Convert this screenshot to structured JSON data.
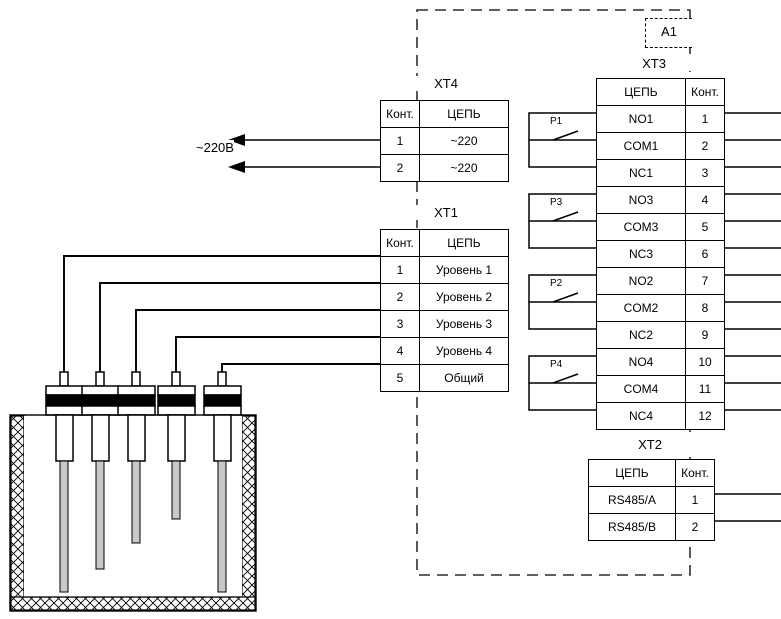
{
  "diagram": {
    "enclosure_label": "A1",
    "mains_label": "~220В",
    "header_pin": "Конт.",
    "header_circuit": "ЦЕПЬ"
  },
  "terminals": {
    "xt4": {
      "title": "XT4",
      "columns": [
        "Конт.",
        "ЦЕПЬ"
      ],
      "rows": [
        {
          "pin": "1",
          "circuit": "~220"
        },
        {
          "pin": "2",
          "circuit": "~220"
        }
      ]
    },
    "xt1": {
      "title": "XT1",
      "columns": [
        "Конт.",
        "ЦЕПЬ"
      ],
      "rows": [
        {
          "pin": "1",
          "circuit": "Уровень 1"
        },
        {
          "pin": "2",
          "circuit": "Уровень 2"
        },
        {
          "pin": "3",
          "circuit": "Уровень 3"
        },
        {
          "pin": "4",
          "circuit": "Уровень 4"
        },
        {
          "pin": "5",
          "circuit": "Общий"
        }
      ]
    },
    "xt3": {
      "title": "XT3",
      "columns": [
        "ЦЕПЬ",
        "Конт."
      ],
      "rows": [
        {
          "circuit": "NO1",
          "pin": "1"
        },
        {
          "circuit": "COM1",
          "pin": "2"
        },
        {
          "circuit": "NC1",
          "pin": "3"
        },
        {
          "circuit": "NO3",
          "pin": "4"
        },
        {
          "circuit": "COM3",
          "pin": "5"
        },
        {
          "circuit": "NC3",
          "pin": "6"
        },
        {
          "circuit": "NO2",
          "pin": "7"
        },
        {
          "circuit": "COM2",
          "pin": "8"
        },
        {
          "circuit": "NC2",
          "pin": "9"
        },
        {
          "circuit": "NO4",
          "pin": "10"
        },
        {
          "circuit": "COM4",
          "pin": "11"
        },
        {
          "circuit": "NC4",
          "pin": "12"
        }
      ]
    },
    "xt2": {
      "title": "XT2",
      "columns": [
        "ЦЕПЬ",
        "Конт."
      ],
      "rows": [
        {
          "circuit": "RS485/A",
          "pin": "1"
        },
        {
          "circuit": "RS485/B",
          "pin": "2"
        }
      ]
    }
  },
  "relays": [
    {
      "label": "P1"
    },
    {
      "label": "P3"
    },
    {
      "label": "P2"
    },
    {
      "label": "P4"
    }
  ],
  "colors": {
    "line": "#000000",
    "rod_fill": "#c8c8c8",
    "background": "#ffffff"
  }
}
